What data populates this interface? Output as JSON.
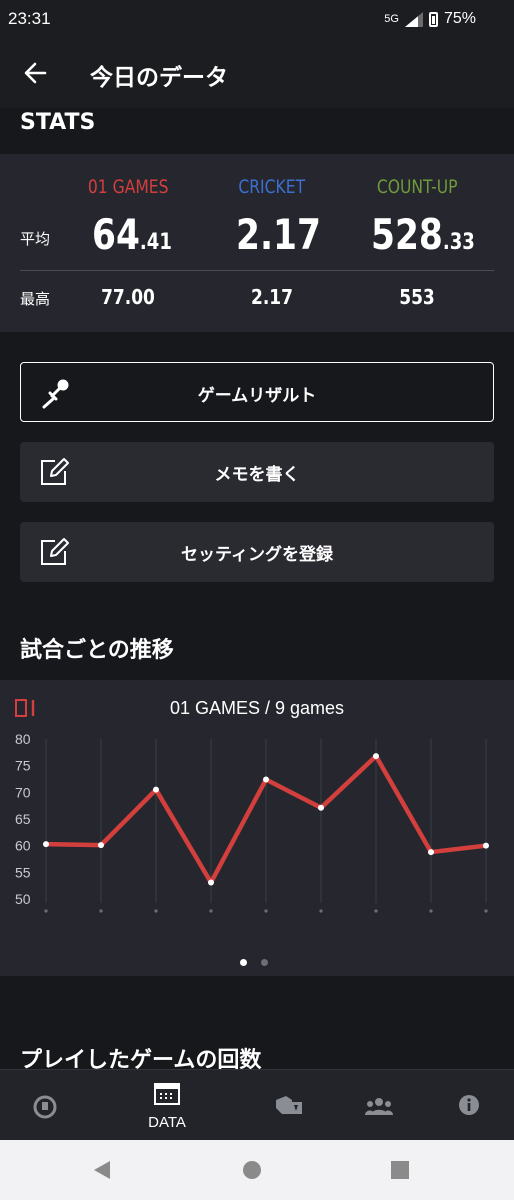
{
  "status": {
    "time": "23:31",
    "network": "5G",
    "battery": "75%"
  },
  "app_bar": {
    "title": "今日のデータ"
  },
  "stats": {
    "section_title": "STATS",
    "row_avg_label": "平均",
    "row_max_label": "最高",
    "columns": [
      {
        "name": "01 GAMES",
        "color": "#d23f3c",
        "avg_int": "64",
        "avg_dec": ".41",
        "max": "77.00"
      },
      {
        "name": "CRICKET",
        "color": "#3d6fd1",
        "avg_int": "2.17",
        "avg_dec": "",
        "max": "2.17"
      },
      {
        "name": "COUNT-UP",
        "color": "#6f9a3c",
        "avg_int": "528",
        "avg_dec": ".33",
        "max": "553"
      }
    ]
  },
  "actions": {
    "game_result": "ゲームリザルト",
    "memo": "メモを書く",
    "setting": "セッティングを登録"
  },
  "trend": {
    "section_title": "試合ごとの推移",
    "badge": "01",
    "chart_title": "01 GAMES / 9 games"
  },
  "chart_data": {
    "type": "line",
    "title": "01 GAMES / 9 games",
    "x": [
      1,
      2,
      3,
      4,
      5,
      6,
      7,
      8,
      9
    ],
    "values": [
      60.3,
      60.1,
      70.5,
      53.1,
      72.4,
      67.1,
      76.8,
      58.8,
      60.0
    ],
    "ylim": [
      50,
      80
    ],
    "yticks": [
      50,
      55,
      60,
      65,
      70,
      75,
      80
    ],
    "grid": true,
    "line_color": "#d23f3c"
  },
  "pager": {
    "count": 2,
    "active": 0
  },
  "cut_section": {
    "title": "プレイしたゲームの回数"
  },
  "bottom_nav": {
    "items": [
      {
        "name": "home",
        "icon": "gauge-icon",
        "label": ""
      },
      {
        "name": "data",
        "icon": "calendar-icon",
        "label": "DATA"
      },
      {
        "name": "darts",
        "icon": "shop-icon",
        "label": ""
      },
      {
        "name": "friends",
        "icon": "group-icon",
        "label": ""
      },
      {
        "name": "info",
        "icon": "info-icon",
        "label": ""
      }
    ]
  }
}
